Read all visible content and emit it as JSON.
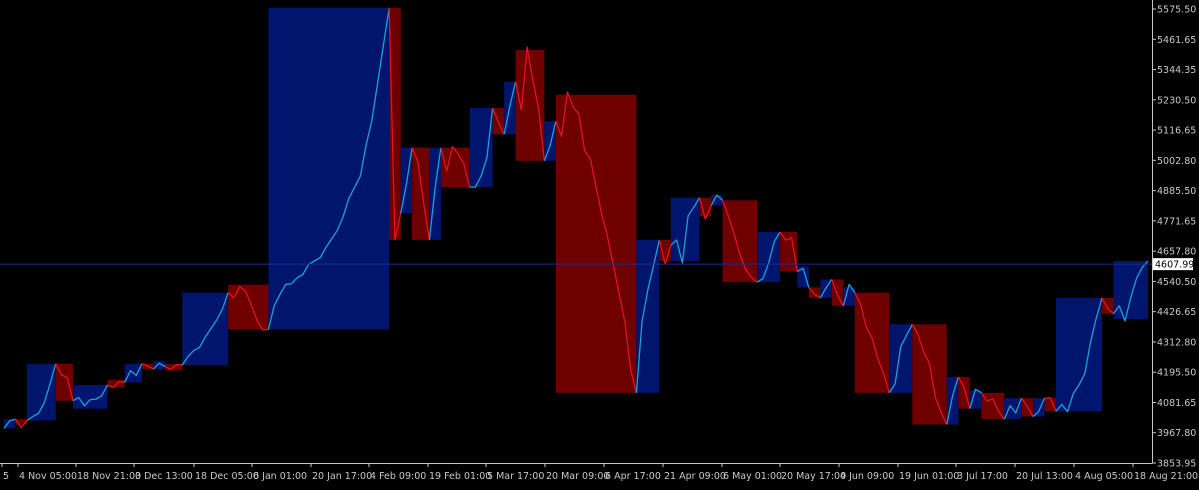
{
  "colors": {
    "background": "#000000",
    "frame": "#c8c8c8",
    "up_box": "#00156e",
    "down_box": "#6e0000",
    "up_line": "#1fa1d4",
    "down_line": "#e0141e",
    "price_line": "#1c2e8c",
    "current_label_bg": "#ffffff",
    "current_label_text": "#000000"
  },
  "chart_data": {
    "type": "line",
    "title": "",
    "xlabel": "",
    "ylabel": "",
    "ylim": [
      3840,
      5595
    ],
    "y_ticks": [
      "5575.50",
      "5461.65",
      "5344.35",
      "5230.50",
      "5116.65",
      "5002.80",
      "4885.50",
      "4771.65",
      "4657.80",
      "4540.50",
      "4426.65",
      "4312.80",
      "4195.50",
      "4081.65",
      "3967.80",
      "3853.95"
    ],
    "x_ticks": [
      "5",
      "4 Nov 05:00",
      "18 Nov 21:00",
      "3 Dec 13:00",
      "18 Dec 05:00",
      "6 Jan 01:00",
      "20 Jan 17:00",
      "4 Feb 09:00",
      "19 Feb 01:00",
      "5 Mar 17:00",
      "20 Mar 09:00",
      "6 Apr 17:00",
      "21 Apr 09:00",
      "6 May 01:00",
      "20 May 17:00",
      "4 Jun 09:00",
      "19 Jun 01:00",
      "3 Jul 17:00",
      "20 Jul 13:00",
      "4 Aug 05:00",
      "18 Aug 21:00"
    ],
    "current_price": 4607.99,
    "series": [
      {
        "values": [
          3985,
          4010,
          4020,
          4000,
          4015,
          4030,
          4050,
          4070,
          4150,
          4230,
          4200,
          4170,
          4090,
          4110,
          4060,
          4090,
          4100,
          4120,
          4150,
          4140,
          4170,
          4160,
          4200,
          4190,
          4230,
          4215,
          4210,
          4240,
          4220,
          4205,
          4230,
          4225,
          4250,
          4280,
          4300,
          4320,
          4360,
          4400,
          4450,
          4500,
          4480,
          4530,
          4495,
          4450,
          4400,
          4370,
          4360,
          4450,
          4500,
          4520,
          4530,
          4560,
          4580,
          4600,
          4620,
          4640,
          4660,
          4700,
          4740,
          4800,
          4850,
          4900,
          4950,
          5050,
          5150,
          5300,
          5450,
          5580,
          4700,
          4800,
          4900,
          5050,
          5000,
          4850,
          4700,
          4900,
          5050,
          4950,
          5050,
          5030,
          5000,
          4900,
          4900,
          4950,
          5000,
          5200,
          5150,
          5100,
          5200,
          5300,
          5200,
          5420,
          5300,
          5200,
          5000,
          5050,
          5150,
          5100,
          5250,
          5200,
          5180,
          5050,
          5000,
          4900,
          4800,
          4700,
          4600,
          4500,
          4400,
          4200,
          4120,
          4400,
          4500,
          4600,
          4700,
          4620,
          4680,
          4700,
          4620,
          4780,
          4820,
          4860,
          4790,
          4830,
          4870,
          4850,
          4780,
          4720,
          4650,
          4600,
          4550,
          4540,
          4560,
          4600,
          4690,
          4730,
          4710,
          4700,
          4580,
          4600,
          4520,
          4490,
          4480,
          4530,
          4550,
          4490,
          4450,
          4520,
          4500,
          4460,
          4380,
          4320,
          4250,
          4200,
          4120,
          4150,
          4300,
          4350,
          4380,
          4340,
          4280,
          4220,
          4100,
          4050,
          4000,
          4100,
          4180,
          4150,
          4060,
          4130,
          4120,
          4100,
          4090,
          4050,
          4020,
          4060,
          4040,
          4100,
          4080,
          4030,
          4050,
          4100,
          4090,
          4050,
          4080,
          4060,
          4110,
          4150,
          4200,
          4300,
          4400,
          4480,
          4450,
          4420,
          4450,
          4400,
          4470,
          4550,
          4600,
          4620
        ]
      }
    ]
  }
}
